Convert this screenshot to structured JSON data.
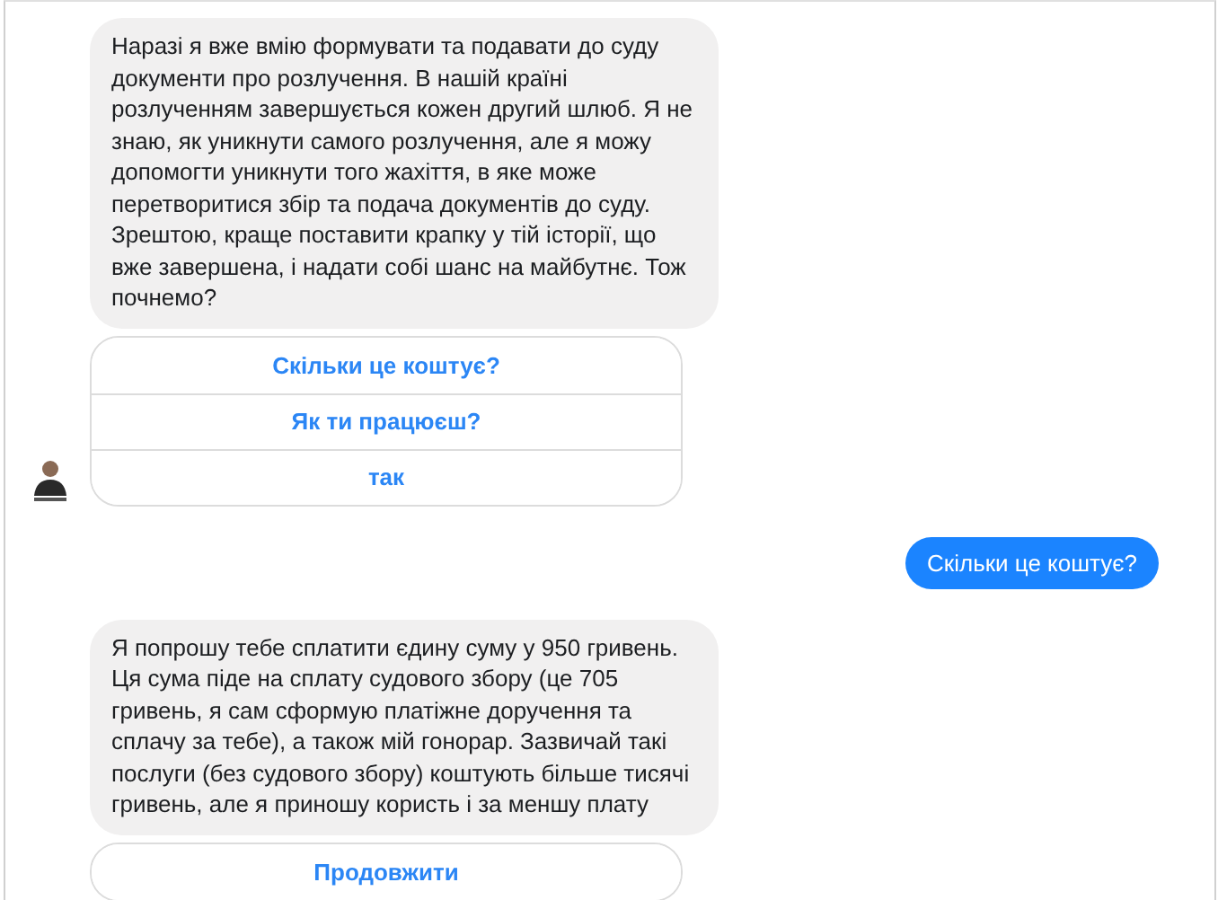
{
  "messages": [
    {
      "kind": "bot",
      "text": "Наразі я вже вмію формувати та подавати до суду документи про розлучення. В нашій країні розлученням завершується кожен другий шлюб. Я не знаю, як уникнути самого розлучення, але я можу допомогти уникнути того жахіття, в яке може перетворитися збір та подача документів до суду.  Зрештою, краще поставити крапку у тій історії, що вже завершена, і надати собі шанс на майбутнє. Тож почнемо?",
      "quick_replies": [
        "Скільки це коштує?",
        "Як ти працюєш?",
        "так"
      ]
    },
    {
      "kind": "user",
      "text": "Скільки це коштує?"
    },
    {
      "kind": "bot",
      "text": "Я попрошу тебе сплатити єдину суму у 950 гривень. Ця сума піде на сплату судового збору (це 705 гривень, я сам сформую платіжне доручення та сплачу за тебе), а також  мій гонорар. Зазвичай такі послуги (без судового збору) коштують більше тисячі гривень, але я приношу  користь і за меншу плату",
      "quick_replies": [
        "Продовжити"
      ]
    }
  ]
}
